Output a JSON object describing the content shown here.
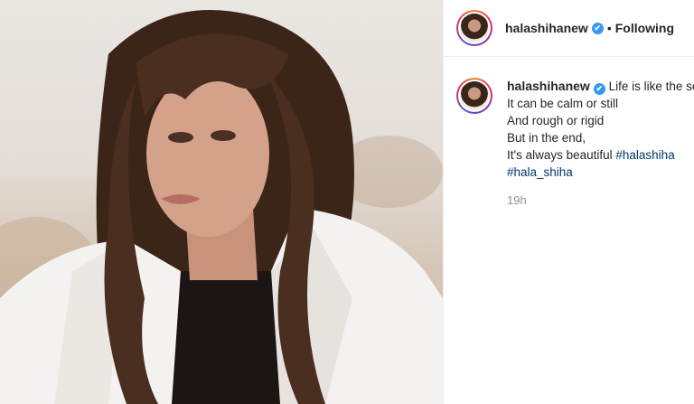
{
  "post": {
    "username": "halashihanew",
    "verified_icon": "✔",
    "separator": "•",
    "follow_status": "Following",
    "caption_first": "Life is like the sea",
    "caption_lines": [
      "It can be calm or still",
      "And rough or rigid",
      "But in the end,"
    ],
    "caption_last_text": "It's always beautiful ",
    "hashtags": [
      "#halashiha",
      "#hala_shiha"
    ],
    "time_ago": "19h"
  },
  "icons": {
    "avatar": "profile-avatar",
    "verified": "verified-badge-icon"
  },
  "colors": {
    "accent_blue": "#3897f0",
    "hashtag": "#00376b",
    "muted": "#8e8e8e"
  }
}
